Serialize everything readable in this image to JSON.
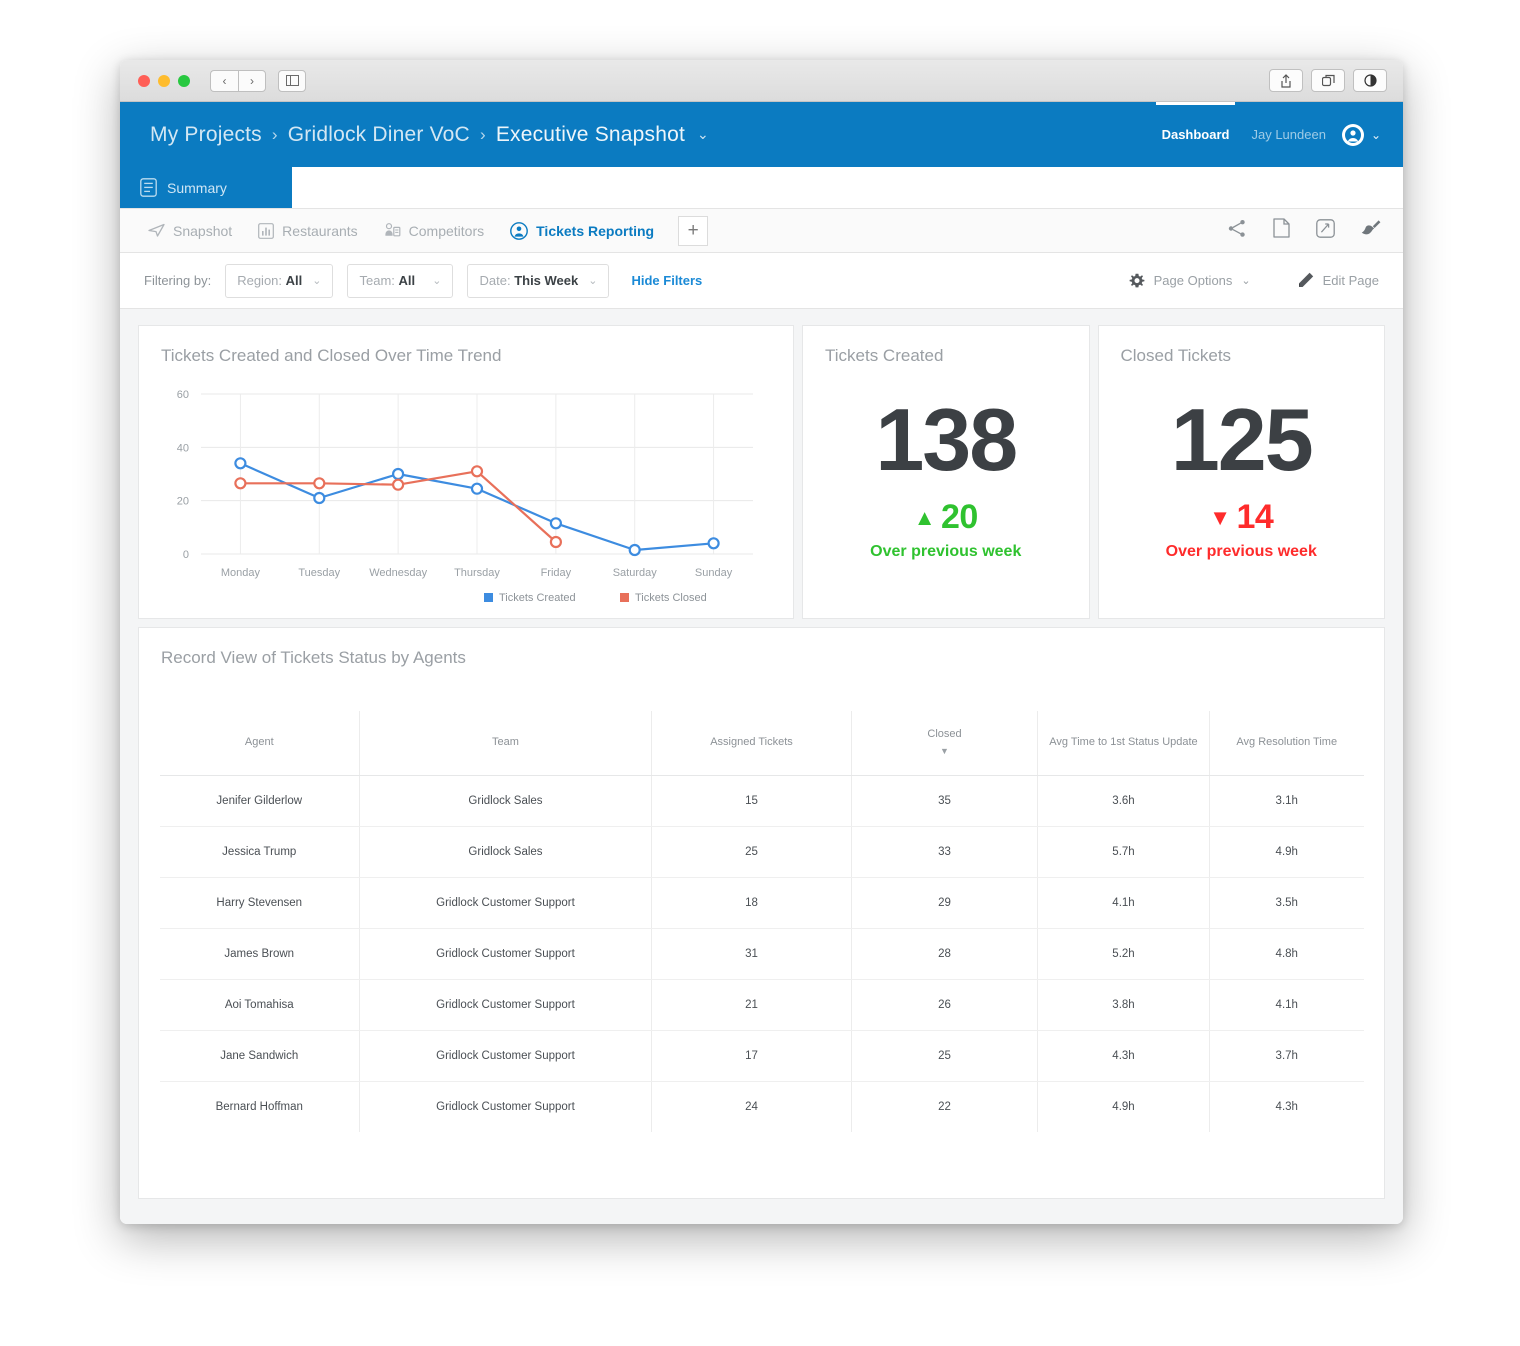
{
  "window": {
    "traffic_lights": [
      "close",
      "minimize",
      "maximize"
    ],
    "nav_back": "‹",
    "nav_forward": "›",
    "sidebar_toggle": "sidebar-icon",
    "toolbar_icons": [
      "share-icon",
      "duplicate-tab-icon",
      "appearance-icon"
    ]
  },
  "header": {
    "breadcrumb": [
      "My Projects",
      "Gridlock Diner VoC",
      "Executive Snapshot"
    ],
    "separator": "›",
    "caret": "⌄",
    "dashboard_tab": "Dashboard",
    "user_name": "Jay Lundeen",
    "avatar_icon": "user-avatar-icon",
    "avatar_caret": "⌄"
  },
  "summary": {
    "label": "Summary",
    "icon": "document-list-icon"
  },
  "page_tabs": [
    {
      "label": "Snapshot",
      "icon": "paper-plane-icon",
      "active": false
    },
    {
      "label": "Restaurants",
      "icon": "bar-chart-icon",
      "active": false
    },
    {
      "label": "Competitors",
      "icon": "competitors-icon",
      "active": false
    },
    {
      "label": "Tickets Reporting",
      "icon": "ticket-person-icon",
      "active": true
    }
  ],
  "add_tab_label": "+",
  "tab_actions": [
    "share-icon",
    "page-icon",
    "fullscreen-icon",
    "brush-icon"
  ],
  "filters": {
    "label": "Filtering by:",
    "chips": [
      {
        "name": "Region",
        "value": "All"
      },
      {
        "name": "Team",
        "value": "All"
      },
      {
        "name": "Date",
        "value": "This Week"
      }
    ],
    "hide_filters": "Hide Filters",
    "page_options": "Page Options",
    "page_options_icon": "gear-icon",
    "page_options_caret": "⌄",
    "edit_page": "Edit Page",
    "edit_page_icon": "pencil-icon"
  },
  "cards": {
    "chart_title": "Tickets Created and Closed Over Time Trend",
    "kpi1": {
      "title": "Tickets Created",
      "value": "138",
      "delta": "20",
      "delta_arrow": "▲",
      "delta_direction": "up",
      "sub": "Over previous week",
      "color": "#2fc22f"
    },
    "kpi2": {
      "title": "Closed Tickets",
      "value": "125",
      "delta": "14",
      "delta_arrow": "▼",
      "delta_direction": "down",
      "sub": "Over previous week",
      "color": "#fe2b2b"
    }
  },
  "table": {
    "title": "Record View of Tickets Status by Agents",
    "columns": [
      {
        "label": "Agent",
        "sorted": false
      },
      {
        "label": "Team",
        "sorted": false
      },
      {
        "label": "Assigned Tickets",
        "sorted": false
      },
      {
        "label": "Closed",
        "sorted": true,
        "sort_caret": "▼"
      },
      {
        "label": "Avg Time to 1st Status Update",
        "sorted": false
      },
      {
        "label": "Avg Resolution Time",
        "sorted": false
      }
    ],
    "rows": [
      {
        "agent": "Jenifer Gilderlow",
        "team": "Gridlock Sales",
        "assigned": "15",
        "closed": "35",
        "first_update": "3.6h",
        "resolution": "3.1h"
      },
      {
        "agent": "Jessica Trump",
        "team": "Gridlock Sales",
        "assigned": "25",
        "closed": "33",
        "first_update": "5.7h",
        "resolution": "4.9h"
      },
      {
        "agent": "Harry Stevensen",
        "team": "Gridlock Customer Support",
        "assigned": "18",
        "closed": "29",
        "first_update": "4.1h",
        "resolution": "3.5h"
      },
      {
        "agent": "James Brown",
        "team": "Gridlock Customer Support",
        "assigned": "31",
        "closed": "28",
        "first_update": "5.2h",
        "resolution": "4.8h"
      },
      {
        "agent": "Aoi Tomahisa",
        "team": "Gridlock Customer Support",
        "assigned": "21",
        "closed": "26",
        "first_update": "3.8h",
        "resolution": "4.1h"
      },
      {
        "agent": "Jane Sandwich",
        "team": "Gridlock Customer Support",
        "assigned": "17",
        "closed": "25",
        "first_update": "4.3h",
        "resolution": "3.7h"
      },
      {
        "agent": "Bernard Hoffman",
        "team": "Gridlock Customer Support",
        "assigned": "24",
        "closed": "22",
        "first_update": "4.9h",
        "resolution": "4.3h"
      }
    ]
  },
  "chart_data": {
    "type": "line",
    "title": "Tickets Created and Closed Over Time Trend",
    "xlabel": "",
    "ylabel": "",
    "categories": [
      "Monday",
      "Tuesday",
      "Wednesday",
      "Thursday",
      "Friday",
      "Saturday",
      "Sunday"
    ],
    "yticks": [
      0,
      20,
      40,
      60
    ],
    "ylim": [
      0,
      60
    ],
    "grid": true,
    "legend_position": "bottom",
    "series": [
      {
        "name": "Tickets Created",
        "color": "#3d8ce0",
        "values": [
          34,
          21,
          30,
          24.5,
          11.5,
          1.5,
          4
        ]
      },
      {
        "name": "Tickets Closed",
        "color": "#e8705a",
        "values": [
          26.5,
          26.5,
          26,
          31,
          4.5,
          null,
          null
        ]
      }
    ]
  },
  "colors": {
    "brand_blue": "#0b7bc1",
    "link_blue": "#1b8ad6",
    "series_created": "#3d8ce0",
    "series_closed": "#e8705a",
    "up_green": "#2fc22f",
    "down_red": "#fe2b2b"
  }
}
